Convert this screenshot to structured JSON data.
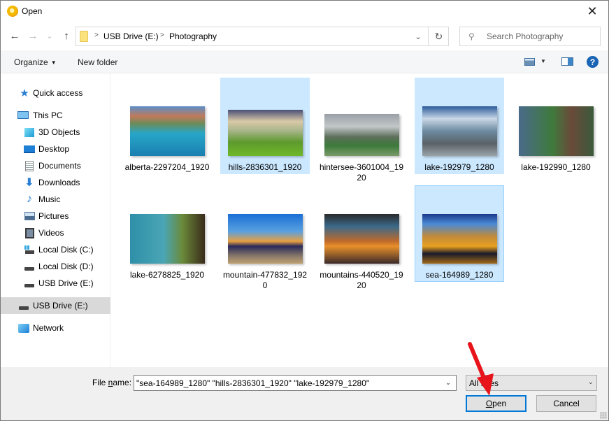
{
  "window": {
    "title": "Open",
    "close_label": "✕"
  },
  "nav": {
    "back": "←",
    "forward": "→",
    "recent": "⌄",
    "up": "↑",
    "breadcrumb": [
      "USB Drive (E:)",
      "Photography"
    ],
    "crumb_separator": ">",
    "address_dropdown": "⌄",
    "refresh": "↻",
    "search_placeholder": "Search Photography",
    "search_icon": "⚲"
  },
  "commandbar": {
    "organize_label": "Organize",
    "new_folder_label": "New folder",
    "help_label": "?"
  },
  "sidebar": {
    "items": [
      {
        "label": "Quick access",
        "icon": "star-icon"
      },
      {
        "label": "This PC",
        "icon": "computer-icon"
      },
      {
        "label": "3D Objects",
        "icon": "3d-objects-icon"
      },
      {
        "label": "Desktop",
        "icon": "desktop-icon"
      },
      {
        "label": "Documents",
        "icon": "documents-icon"
      },
      {
        "label": "Downloads",
        "icon": "downloads-icon"
      },
      {
        "label": "Music",
        "icon": "music-icon"
      },
      {
        "label": "Pictures",
        "icon": "pictures-icon"
      },
      {
        "label": "Videos",
        "icon": "videos-icon"
      },
      {
        "label": "Local Disk (C:)",
        "icon": "system-drive-icon"
      },
      {
        "label": "Local Disk (D:)",
        "icon": "drive-icon"
      },
      {
        "label": "USB Drive (E:)",
        "icon": "usb-drive-icon"
      },
      {
        "label": "USB Drive (E:)",
        "icon": "usb-drive-icon",
        "selected": true
      },
      {
        "label": "Network",
        "icon": "network-icon"
      }
    ]
  },
  "files": [
    {
      "name": "alberta-2297204_1920",
      "selected": false
    },
    {
      "name": "hills-2836301_1920",
      "selected": true
    },
    {
      "name": "hintersee-3601004_1920",
      "selected": false
    },
    {
      "name": "lake-192979_1280",
      "selected": true
    },
    {
      "name": "lake-192990_1280",
      "selected": false
    },
    {
      "name": "lake-6278825_1920",
      "selected": false
    },
    {
      "name": "mountain-477832_1920",
      "selected": false
    },
    {
      "name": "mountains-440520_1920",
      "selected": false
    },
    {
      "name": "sea-164989_1280",
      "selected": true,
      "focused": true
    }
  ],
  "footer": {
    "file_name_label_prefix": "File ",
    "file_name_label_accel": "n",
    "file_name_label_suffix": "ame:",
    "file_name_value": "\"sea-164989_1280\" \"hills-2836301_1920\" \"lake-192979_1280\"",
    "file_type_value": "All Files",
    "open_label_accel": "O",
    "open_label_rest": "pen",
    "cancel_label": "Cancel"
  },
  "colors": {
    "selection": "#cce8ff",
    "selection_border": "#99d1ff",
    "accent": "#0078d7",
    "annotation_arrow": "#e8141c"
  }
}
